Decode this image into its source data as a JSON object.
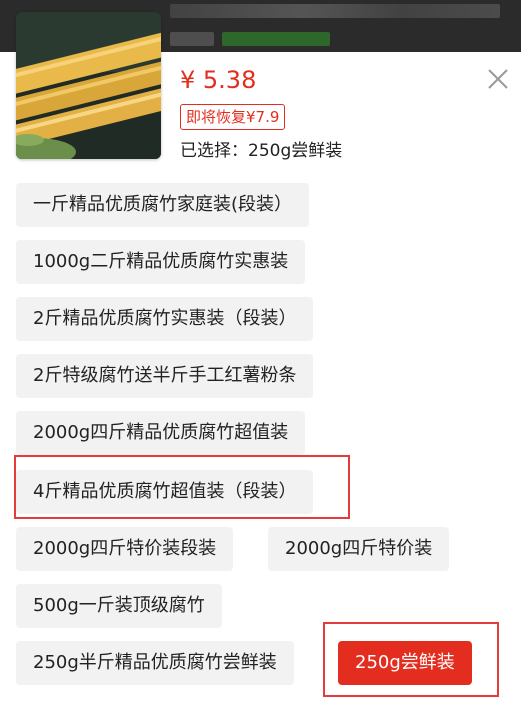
{
  "product": {
    "price": "¥ 5.38",
    "restore_badge": "即将恢复¥7.9",
    "selected_label": "已选择：",
    "selected_value": "250g尝鲜装"
  },
  "icons": {
    "close": "close-icon"
  },
  "colors": {
    "accent": "#e22d1f",
    "option_bg": "#f2f2f2",
    "highlight": "#e43c3c"
  },
  "options": [
    {
      "label": "一斤精品优质腐竹家庭装(段装）",
      "selected": false
    },
    {
      "label": "1000g二斤精品优质腐竹实惠装",
      "selected": false
    },
    {
      "label": "2斤精品优质腐竹实惠装（段装）",
      "selected": false
    },
    {
      "label": "2斤特级腐竹送半斤手工红薯粉条",
      "selected": false
    },
    {
      "label": "2000g四斤精品优质腐竹超值装",
      "selected": false
    },
    {
      "label": "4斤精品优质腐竹超值装（段装）",
      "selected": false
    },
    {
      "label": "2000g四斤特价装段装",
      "selected": false
    },
    {
      "label": "2000g四斤特价装",
      "selected": false
    },
    {
      "label": "500g一斤装顶级腐竹",
      "selected": false
    },
    {
      "label": "250g半斤精品优质腐竹尝鲜装",
      "selected": false
    },
    {
      "label": "250g尝鲜装",
      "selected": true
    }
  ]
}
